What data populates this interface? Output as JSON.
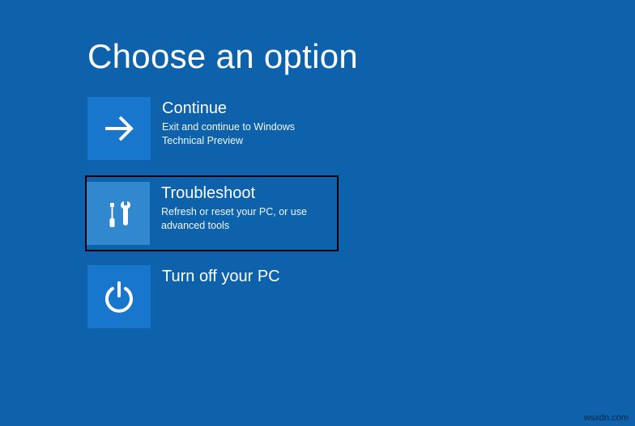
{
  "header": {
    "title": "Choose an option"
  },
  "options": {
    "continue": {
      "title": "Continue",
      "description": "Exit and continue to Windows Technical Preview",
      "icon": "arrow-right-icon"
    },
    "troubleshoot": {
      "title": "Troubleshoot",
      "description": "Refresh or reset your PC, or use advanced tools",
      "icon": "tools-icon",
      "highlighted": true
    },
    "turnoff": {
      "title": "Turn off your PC",
      "description": "",
      "icon": "power-icon"
    }
  },
  "watermark": "wsxdn.com"
}
